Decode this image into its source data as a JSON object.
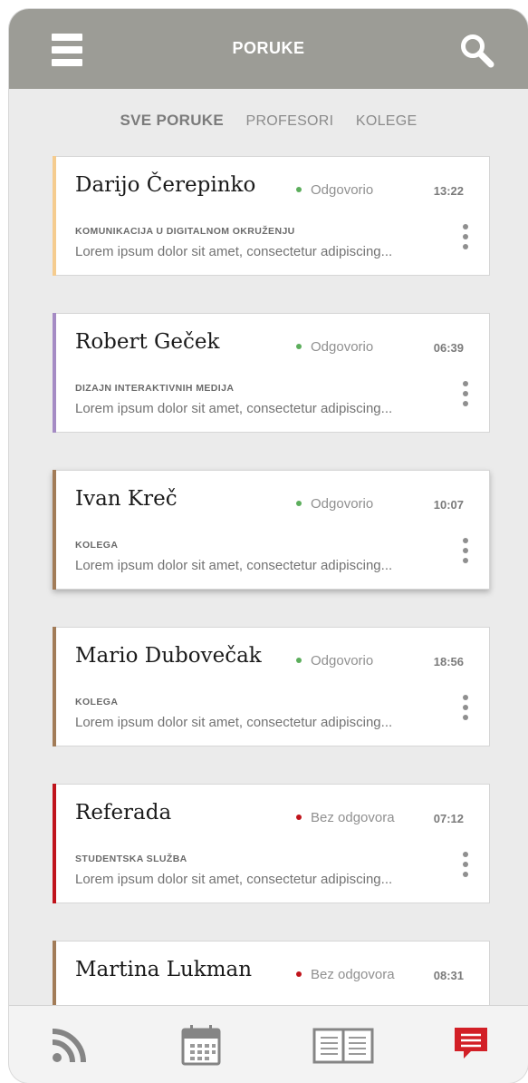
{
  "header": {
    "title": "PORUKE",
    "menu_icon": "menu-icon",
    "search_icon": "search-icon"
  },
  "tabs": [
    {
      "label": "SVE PORUKE",
      "active": true
    },
    {
      "label": "PROFESORI",
      "active": false
    },
    {
      "label": "KOLEGE",
      "active": false
    }
  ],
  "colors": {
    "header_bg": "#9c9c96",
    "replied_dot": "#5cae5c",
    "unreplied_dot": "#c0141c",
    "active_nav": "#d21f26"
  },
  "messages": [
    {
      "name": "Darijo Čerepinko",
      "status": "Odgovorio",
      "time": "13:22",
      "subject": "KOMUNIKACIJA U DIGITALNOM OKRUŽENJU",
      "preview": "Lorem ipsum dolor sit amet, consectetur adipiscing...",
      "accent": "#f5cc8f",
      "dot": "#5cae5c"
    },
    {
      "name": "Robert Geček",
      "status": "Odgovorio",
      "time": "06:39",
      "subject": "DIZAJN INTERAKTIVNIH MEDIJA",
      "preview": "Lorem ipsum dolor sit amet, consectetur adipiscing...",
      "accent": "#a58bc4",
      "dot": "#5cae5c"
    },
    {
      "name": "Ivan Kreč",
      "status": "Odgovorio",
      "time": "10:07",
      "subject": "KOLEGA",
      "preview": "Lorem ipsum dolor sit amet, consectetur adipiscing...",
      "accent": "#a27c58",
      "dot": "#5cae5c"
    },
    {
      "name": "Mario Dubovečak",
      "status": "Odgovorio",
      "time": "18:56",
      "subject": "KOLEGA",
      "preview": "Lorem ipsum dolor sit amet, consectetur adipiscing...",
      "accent": "#a27c58",
      "dot": "#5cae5c"
    },
    {
      "name": "Referada",
      "status": "Bez odgovora",
      "time": "07:12",
      "subject": "STUDENTSKA SLUŽBA",
      "preview": "Lorem ipsum dolor sit amet, consectetur adipiscing...",
      "accent": "#c0141c",
      "dot": "#c0141c"
    },
    {
      "name": "Martina Lukman",
      "status": "Bez odgovora",
      "time": "08:31",
      "subject": "",
      "preview": "",
      "accent": "#a27c58",
      "dot": "#c0141c"
    }
  ],
  "bottom_nav": [
    {
      "icon": "rss-feed-icon",
      "active": false
    },
    {
      "icon": "calendar-icon",
      "active": false
    },
    {
      "icon": "book-icon",
      "active": false
    },
    {
      "icon": "messages-icon",
      "active": true
    }
  ]
}
